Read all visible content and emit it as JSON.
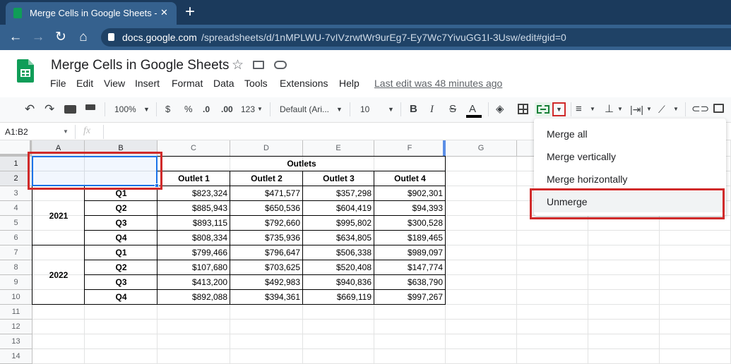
{
  "browser": {
    "tab_title": "Merge Cells in Google Sheets - G",
    "tab_close": "✕",
    "new_tab": "+",
    "url_domain": "docs.google.com",
    "url_path": "/spreadsheets/d/1nMPLWU-7vIVzrwtWr9urEg7-Ey7Wc7YivuGG1I-3Usw/edit#gid=0"
  },
  "doc": {
    "title": "Merge Cells in Google Sheets",
    "menu": [
      "File",
      "Edit",
      "View",
      "Insert",
      "Format",
      "Data",
      "Tools",
      "Extensions",
      "Help"
    ],
    "last_edit": "Last edit was 48 minutes ago"
  },
  "toolbar": {
    "zoom": "100%",
    "currency": "$",
    "percent": "%",
    "decrease_decimal": ".0",
    "increase_decimal": ".00",
    "number_format": "123",
    "font": "Default (Ari...",
    "font_size": "10",
    "bold": "B",
    "italic": "I",
    "strike": "S",
    "text_color": "A"
  },
  "formula_bar": {
    "name_box": "A1:B2",
    "fx": "fx"
  },
  "columns": [
    "A",
    "B",
    "C",
    "D",
    "E",
    "F",
    "G"
  ],
  "rows": [
    "1",
    "2",
    "3",
    "4",
    "5",
    "6",
    "7",
    "8",
    "9",
    "10",
    "11",
    "12",
    "13",
    "14"
  ],
  "sheet": {
    "outlets_header": "Outlets",
    "outlet_headers": [
      "Outlet 1",
      "Outlet 2",
      "Outlet 3",
      "Outlet 4"
    ],
    "years": [
      "2021",
      "2022"
    ],
    "data": [
      {
        "q": "Q1",
        "v": [
          "$823,324",
          "$471,577",
          "$357,298",
          "$902,301"
        ]
      },
      {
        "q": "Q2",
        "v": [
          "$885,943",
          "$650,536",
          "$604,419",
          "$94,393"
        ]
      },
      {
        "q": "Q3",
        "v": [
          "$893,115",
          "$792,660",
          "$995,802",
          "$300,528"
        ]
      },
      {
        "q": "Q4",
        "v": [
          "$808,334",
          "$735,936",
          "$634,805",
          "$189,465"
        ]
      },
      {
        "q": "Q1",
        "v": [
          "$799,466",
          "$796,647",
          "$506,338",
          "$989,097"
        ]
      },
      {
        "q": "Q2",
        "v": [
          "$107,680",
          "$703,625",
          "$520,408",
          "$147,774"
        ]
      },
      {
        "q": "Q3",
        "v": [
          "$413,200",
          "$492,983",
          "$940,836",
          "$638,790"
        ]
      },
      {
        "q": "Q4",
        "v": [
          "$892,088",
          "$394,361",
          "$669,119",
          "$997,267"
        ]
      }
    ]
  },
  "merge_menu": {
    "items": [
      "Merge all",
      "Merge vertically",
      "Merge horizontally",
      "Unmerge"
    ]
  },
  "colors": {
    "highlight": "#d02a2a",
    "selection": "#1a73e8",
    "sheets_green": "#0f9d58"
  }
}
